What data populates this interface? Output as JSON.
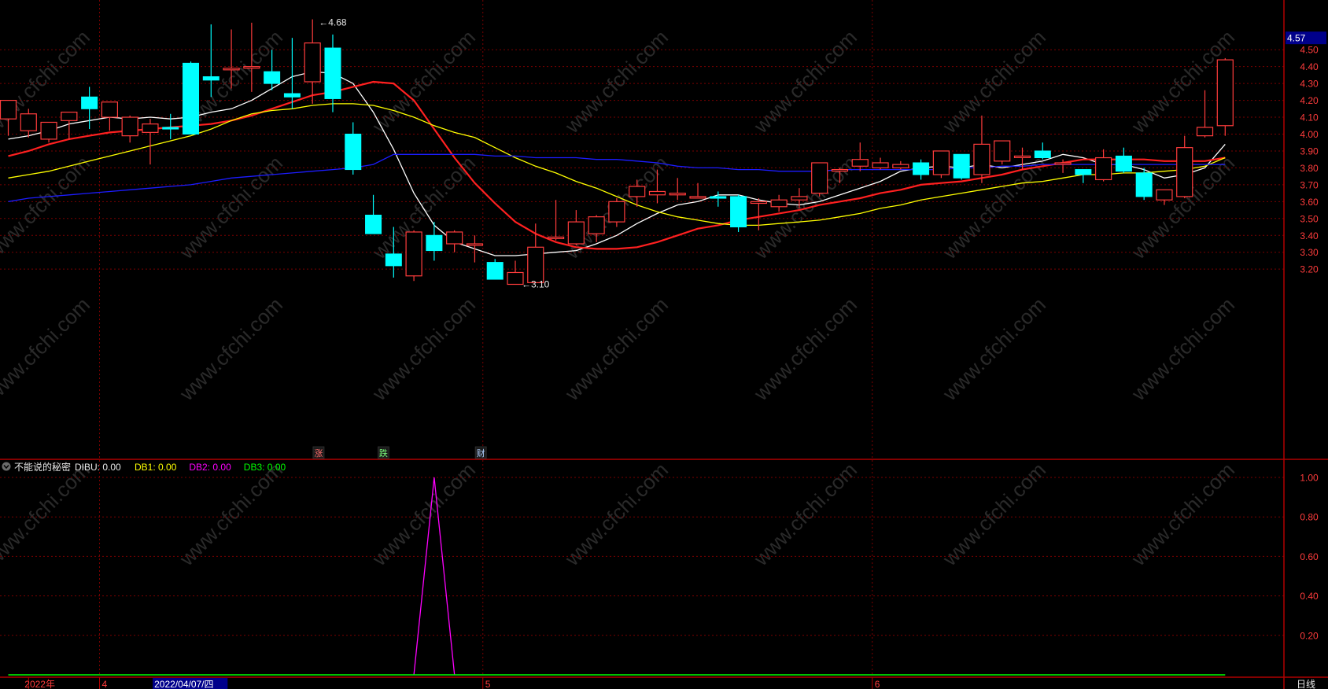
{
  "chart_data": [
    {
      "type": "candlestick",
      "price_axis": {
        "ticks": [
          "4.50",
          "4.40",
          "4.30",
          "4.20",
          "4.10",
          "4.00",
          "3.90",
          "3.80",
          "3.70",
          "3.60",
          "3.50",
          "3.40",
          "3.30",
          "3.20"
        ],
        "current_price": "4.57"
      },
      "annotations": {
        "high": "4.68",
        "low": "3.10"
      },
      "event_markers": [
        "涨",
        "跌",
        "财"
      ],
      "colors": {
        "up": "#ff3c3c",
        "down": "#00ffff",
        "ma5": "#ffffff",
        "ma10": "#ff2020",
        "ma20": "#ffff00",
        "ma60": "#1c1cff",
        "grid": "#7a0000",
        "axis": "#b00000",
        "price_text": "#ff3c3c"
      },
      "candles": [
        [
          3.99,
          4.12,
          4.09,
          4.2
        ],
        [
          3.98,
          4.15,
          4.02,
          4.12
        ],
        [
          3.95,
          4.07,
          3.97,
          4.07
        ],
        [
          3.97,
          4.09,
          4.08,
          4.13
        ],
        [
          4.03,
          4.28,
          4.22,
          4.15
        ],
        [
          4.02,
          4.19,
          4.1,
          4.19
        ],
        [
          3.95,
          4.11,
          3.99,
          4.1
        ],
        [
          3.82,
          4.09,
          4.01,
          4.06
        ],
        [
          3.97,
          4.12,
          4.04,
          4.03
        ],
        [
          4.0,
          4.43,
          4.42,
          4.0
        ],
        [
          4.22,
          4.65,
          4.34,
          4.32
        ],
        [
          4.27,
          4.62,
          4.39,
          4.39
        ],
        [
          4.25,
          4.66,
          4.4,
          4.4
        ],
        [
          4.26,
          4.5,
          4.37,
          4.3
        ],
        [
          4.15,
          4.57,
          4.24,
          4.22
        ],
        [
          4.18,
          4.68,
          4.31,
          4.54
        ],
        [
          4.13,
          4.59,
          4.51,
          4.21
        ],
        [
          3.76,
          4.07,
          4.0,
          3.79
        ],
        [
          3.52,
          3.64,
          3.52,
          3.41
        ],
        [
          3.15,
          3.45,
          3.29,
          3.22
        ],
        [
          3.13,
          3.43,
          3.16,
          3.42
        ],
        [
          3.25,
          3.48,
          3.4,
          3.31
        ],
        [
          3.3,
          3.43,
          3.35,
          3.42
        ],
        [
          3.24,
          3.4,
          3.35,
          3.35
        ],
        [
          3.16,
          3.26,
          3.24,
          3.14
        ],
        [
          3.11,
          3.25,
          3.11,
          3.18
        ],
        [
          3.12,
          3.47,
          3.12,
          3.33
        ],
        [
          3.37,
          3.61,
          3.39,
          3.39
        ],
        [
          3.34,
          3.55,
          3.35,
          3.48
        ],
        [
          3.36,
          3.52,
          3.41,
          3.51
        ],
        [
          3.45,
          3.62,
          3.48,
          3.6
        ],
        [
          3.57,
          3.73,
          3.63,
          3.69
        ],
        [
          3.59,
          3.79,
          3.64,
          3.66
        ],
        [
          3.61,
          3.74,
          3.64,
          3.65
        ],
        [
          3.62,
          3.71,
          3.63,
          3.63
        ],
        [
          3.57,
          3.66,
          3.63,
          3.62
        ],
        [
          3.42,
          3.64,
          3.63,
          3.45
        ],
        [
          3.43,
          3.62,
          3.59,
          3.6
        ],
        [
          3.54,
          3.64,
          3.57,
          3.61
        ],
        [
          3.56,
          3.68,
          3.61,
          3.63
        ],
        [
          3.63,
          3.82,
          3.65,
          3.83
        ],
        [
          3.71,
          3.8,
          3.79,
          3.79
        ],
        [
          3.78,
          3.95,
          3.81,
          3.85
        ],
        [
          3.79,
          3.86,
          3.8,
          3.83
        ],
        [
          3.79,
          3.84,
          3.8,
          3.82
        ],
        [
          3.73,
          3.85,
          3.83,
          3.76
        ],
        [
          3.74,
          3.9,
          3.76,
          3.9
        ],
        [
          3.73,
          3.88,
          3.88,
          3.74
        ],
        [
          3.71,
          4.11,
          3.76,
          3.94
        ],
        [
          3.82,
          3.96,
          3.84,
          3.96
        ],
        [
          3.79,
          3.92,
          3.87,
          3.87
        ],
        [
          3.85,
          3.95,
          3.9,
          3.86
        ],
        [
          3.77,
          3.85,
          3.83,
          3.83
        ],
        [
          3.71,
          3.79,
          3.79,
          3.76
        ],
        [
          3.72,
          3.91,
          3.73,
          3.86
        ],
        [
          3.77,
          3.92,
          3.87,
          3.78
        ],
        [
          3.61,
          3.8,
          3.77,
          3.63
        ],
        [
          3.58,
          3.67,
          3.61,
          3.67
        ],
        [
          3.62,
          3.99,
          3.63,
          3.92
        ],
        [
          3.98,
          4.26,
          3.99,
          4.04
        ],
        [
          3.99,
          4.45,
          4.05,
          4.44
        ]
      ],
      "ma_lines": [
        {
          "name": "MA5",
          "values": [
            3.97,
            3.99,
            4.02,
            4.06,
            4.08,
            4.1,
            4.09,
            4.1,
            4.09,
            4.1,
            4.13,
            4.15,
            4.2,
            4.27,
            4.34,
            4.37,
            4.36,
            4.3,
            4.13,
            3.91,
            3.65,
            3.46,
            3.36,
            3.32,
            3.28,
            3.28,
            3.29,
            3.3,
            3.31,
            3.35,
            3.4,
            3.47,
            3.53,
            3.58,
            3.6,
            3.64,
            3.64,
            3.61,
            3.59,
            3.58,
            3.6,
            3.64,
            3.68,
            3.72,
            3.78,
            3.8,
            3.81,
            3.8,
            3.82,
            3.8,
            3.82,
            3.84,
            3.88,
            3.86,
            3.82,
            3.82,
            3.79,
            3.74,
            3.76,
            3.8,
            3.94
          ]
        },
        {
          "name": "MA10",
          "values": [
            3.87,
            3.9,
            3.94,
            3.97,
            3.99,
            4.01,
            4.02,
            4.03,
            4.04,
            4.05,
            4.06,
            4.08,
            4.11,
            4.15,
            4.19,
            4.23,
            4.25,
            4.28,
            4.31,
            4.3,
            4.2,
            4.03,
            3.86,
            3.71,
            3.59,
            3.48,
            3.41,
            3.36,
            3.33,
            3.32,
            3.32,
            3.33,
            3.36,
            3.4,
            3.44,
            3.46,
            3.49,
            3.51,
            3.53,
            3.55,
            3.58,
            3.6,
            3.62,
            3.65,
            3.67,
            3.7,
            3.71,
            3.72,
            3.74,
            3.76,
            3.79,
            3.81,
            3.83,
            3.85,
            3.85,
            3.85,
            3.85,
            3.84,
            3.84,
            3.84,
            3.86
          ]
        },
        {
          "name": "MA20",
          "values": [
            3.74,
            3.76,
            3.78,
            3.81,
            3.84,
            3.87,
            3.9,
            3.93,
            3.96,
            3.99,
            4.03,
            4.08,
            4.12,
            4.14,
            4.15,
            4.17,
            4.18,
            4.18,
            4.17,
            4.14,
            4.1,
            4.05,
            4.01,
            3.98,
            3.92,
            3.86,
            3.81,
            3.77,
            3.72,
            3.68,
            3.63,
            3.58,
            3.54,
            3.51,
            3.49,
            3.47,
            3.46,
            3.46,
            3.47,
            3.48,
            3.49,
            3.51,
            3.53,
            3.56,
            3.58,
            3.61,
            3.63,
            3.65,
            3.67,
            3.69,
            3.71,
            3.72,
            3.74,
            3.76,
            3.76,
            3.77,
            3.77,
            3.78,
            3.79,
            3.81,
            3.86
          ]
        },
        {
          "name": "MA60",
          "values": [
            3.6,
            3.62,
            3.63,
            3.64,
            3.65,
            3.66,
            3.67,
            3.68,
            3.69,
            3.7,
            3.72,
            3.74,
            3.75,
            3.76,
            3.77,
            3.78,
            3.79,
            3.8,
            3.82,
            3.88,
            3.88,
            3.88,
            3.88,
            3.88,
            3.87,
            3.87,
            3.86,
            3.86,
            3.86,
            3.85,
            3.85,
            3.84,
            3.83,
            3.81,
            3.8,
            3.8,
            3.79,
            3.79,
            3.78,
            3.78,
            3.78,
            3.79,
            3.79,
            3.79,
            3.79,
            3.79,
            3.79,
            3.8,
            3.8,
            3.81,
            3.81,
            3.82,
            3.82,
            3.82,
            3.82,
            3.82,
            3.82,
            3.82,
            3.82,
            3.82,
            3.82
          ]
        }
      ]
    },
    {
      "type": "line",
      "title": "不能说的秘密",
      "legend": [
        {
          "label": "DIBU: 0.00",
          "color": "#e8e8e8"
        },
        {
          "label": "DB1: 0.00",
          "color": "#ffff00"
        },
        {
          "label": "DB2: 0.00",
          "color": "#ff00ff"
        },
        {
          "label": "DB3: 0.00",
          "color": "#00ff00"
        }
      ],
      "y_ticks": [
        "1.00",
        "0.80",
        "0.60",
        "0.40",
        "0.20"
      ],
      "ylim": [
        0,
        1
      ],
      "series": [
        {
          "name": "DB2",
          "color": "#ff00ff",
          "points": [
            [
              20,
              0
            ],
            [
              21,
              1
            ],
            [
              22,
              0
            ]
          ]
        },
        {
          "name": "DB3",
          "color": "#00ff00",
          "points": [
            [
              0,
              0
            ],
            [
              60,
              0
            ]
          ]
        }
      ]
    }
  ],
  "x_axis": {
    "labels": [
      {
        "text": "2022年",
        "idx": 1
      },
      {
        "text": "4",
        "idx": 4.5
      },
      {
        "text": "2022/04/07/四",
        "idx": 7.2,
        "highlight": true
      },
      {
        "text": "5",
        "idx": 23.4
      },
      {
        "text": "6",
        "idx": 42.6
      }
    ]
  },
  "period_label": "日线",
  "watermark_text": "www.cfchi.com"
}
